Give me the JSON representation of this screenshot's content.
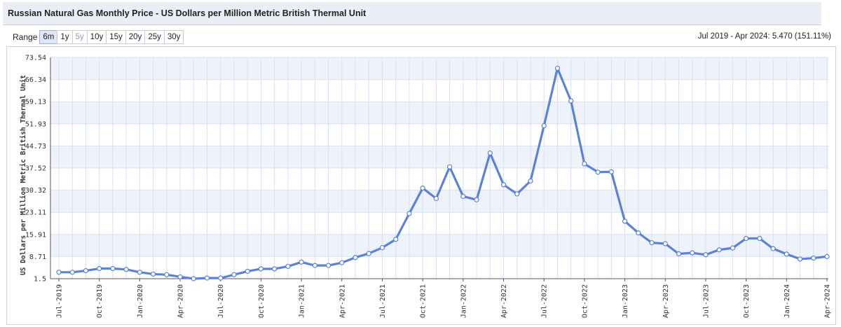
{
  "header": {
    "title": "Russian Natural Gas Monthly Price - US Dollars per Million Metric British Thermal Unit"
  },
  "range": {
    "label": "Range",
    "buttons": [
      {
        "label": "6m",
        "state": "active"
      },
      {
        "label": "1y",
        "state": "normal"
      },
      {
        "label": "5y",
        "state": "disabled"
      },
      {
        "label": "10y",
        "state": "normal"
      },
      {
        "label": "15y",
        "state": "normal"
      },
      {
        "label": "20y",
        "state": "normal"
      },
      {
        "label": "25y",
        "state": "normal"
      },
      {
        "label": "30y",
        "state": "normal"
      }
    ]
  },
  "summary": "Jul 2019 - Apr 2024: 5.470 (151.11%)",
  "colors": {
    "line": "#5b82d6",
    "band": "#eef2fb",
    "grid": "#d7e1f3",
    "title_bg": "#eceef7",
    "accent": "#3b63c7"
  },
  "chart_data": {
    "type": "line",
    "title": "",
    "xlabel": "",
    "ylabel": "US Dollars per Million Metric British Thermal Unit",
    "ylim": [
      1.5,
      73.54
    ],
    "yticks": [
      1.5,
      8.71,
      15.91,
      23.11,
      30.32,
      37.52,
      44.73,
      51.93,
      59.13,
      66.34,
      73.54
    ],
    "ytick_labels": [
      "1.5",
      "8.71",
      "15.91",
      "23.11",
      "30.32",
      "37.52",
      "44.73",
      "51.93",
      "59.13",
      "66.34",
      "73.54"
    ],
    "x": [
      "2019-07",
      "2019-08",
      "2019-09",
      "2019-10",
      "2019-11",
      "2019-12",
      "2020-01",
      "2020-02",
      "2020-03",
      "2020-04",
      "2020-05",
      "2020-06",
      "2020-07",
      "2020-08",
      "2020-09",
      "2020-10",
      "2020-11",
      "2020-12",
      "2021-01",
      "2021-02",
      "2021-03",
      "2021-04",
      "2021-05",
      "2021-06",
      "2021-07",
      "2021-08",
      "2021-09",
      "2021-10",
      "2021-11",
      "2021-12",
      "2022-01",
      "2022-02",
      "2022-03",
      "2022-04",
      "2022-05",
      "2022-06",
      "2022-07",
      "2022-08",
      "2022-09",
      "2022-10",
      "2022-11",
      "2022-12",
      "2023-01",
      "2023-02",
      "2023-03",
      "2023-04",
      "2023-05",
      "2023-06",
      "2023-07",
      "2023-08",
      "2023-09",
      "2023-10",
      "2023-11",
      "2023-12",
      "2024-01",
      "2024-02",
      "2024-03",
      "2024-04"
    ],
    "xtick_labels": [
      "Jul-2019",
      "Oct-2019",
      "Jan-2020",
      "Apr-2020",
      "Jul-2020",
      "Oct-2020",
      "Jan-2021",
      "Apr-2021",
      "Jul-2021",
      "Oct-2021",
      "Jan-2022",
      "Apr-2022",
      "Jul-2022",
      "Oct-2022",
      "Jan-2023",
      "Apr-2023",
      "Jul-2023",
      "Oct-2023",
      "Jan-2024",
      "Apr-2024"
    ],
    "series": [
      {
        "values": [
          3.6,
          3.6,
          4.1,
          4.8,
          4.8,
          4.5,
          3.6,
          3.0,
          2.8,
          2.1,
          1.5,
          1.7,
          1.7,
          2.8,
          3.9,
          4.7,
          4.7,
          5.5,
          6.9,
          5.8,
          5.8,
          6.7,
          8.4,
          9.7,
          11.6,
          14.3,
          22.7,
          31.0,
          27.6,
          37.9,
          28.3,
          27.2,
          42.4,
          32.1,
          29.1,
          33.3,
          51.3,
          70.0,
          59.4,
          38.9,
          36.2,
          36.3,
          20.2,
          16.4,
          13.2,
          12.9,
          9.6,
          9.9,
          9.3,
          10.9,
          11.5,
          14.6,
          14.6,
          11.3,
          9.5,
          7.9,
          8.2,
          8.71
        ]
      }
    ],
    "grid": true,
    "legend": "none"
  }
}
